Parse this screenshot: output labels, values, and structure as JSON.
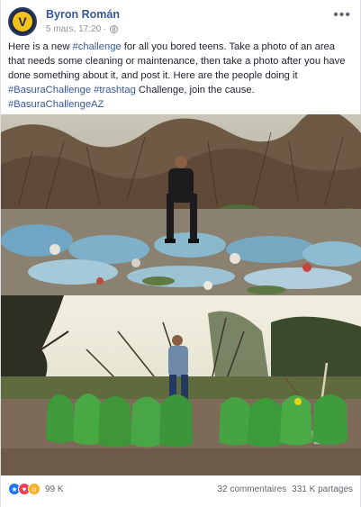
{
  "post": {
    "author": "Byron Román",
    "timestamp": "5 mars, 17:20 ·",
    "avatar_letter": "V",
    "more_label": "•••",
    "text_before": "Here is a new ",
    "tag_challenge": "#challenge",
    "text_middle": " for all you bored teens. Take a photo of an area that needs some cleaning or maintenance, then take a photo after you have done something about it, and post it. Here are the people doing it ",
    "tag_basura": "#BasuraChallenge",
    "tag_trashtag": "#trashtag",
    "text_end": " Challenge, join the cause.",
    "tag_az": "#BasuraChallengeAZ"
  },
  "footer": {
    "reactions_count": "99 K",
    "comments": "32 commentaires",
    "shares": "331 K partages"
  },
  "icons": [
    "globe-icon",
    "more-icon",
    "like-reaction-icon",
    "love-reaction-icon",
    "wow-reaction-icon"
  ],
  "colors": {
    "link": "#385898",
    "text": "#1d2129",
    "muted": "#90949c",
    "like": "#1877f2",
    "love": "#f33e58",
    "wow": "#f7b125"
  }
}
